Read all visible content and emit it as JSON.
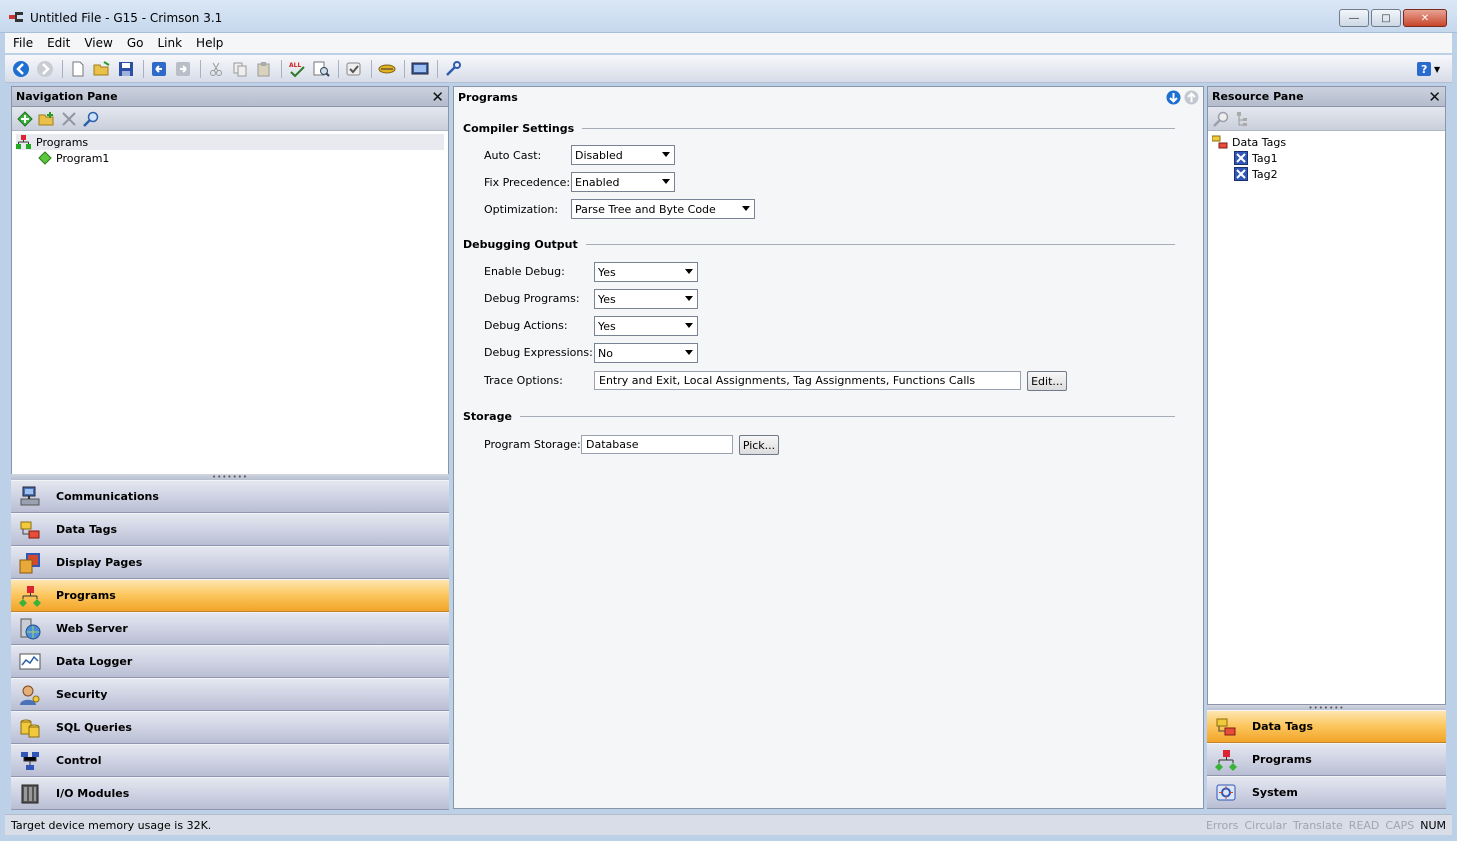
{
  "window": {
    "title": "Untitled File - G15 - Crimson 3.1"
  },
  "menu": [
    "File",
    "Edit",
    "View",
    "Go",
    "Link",
    "Help"
  ],
  "toolbar": {
    "icons": [
      "back-icon",
      "forward-icon",
      "new-file-icon",
      "open-folder-icon",
      "save-icon",
      "undo-icon",
      "redo-icon",
      "cut-icon",
      "copy-icon",
      "paste-icon",
      "spell-check-icon",
      "find-icon",
      "verify-icon",
      "send-icon",
      "screen-icon",
      "tool-icon"
    ],
    "help_icon": "help-icon"
  },
  "nav_pane": {
    "title": "Navigation Pane",
    "tree": [
      {
        "label": "Programs",
        "icon": "programs-icon",
        "level": 0
      },
      {
        "label": "Program1",
        "icon": "program-icon",
        "level": 1
      }
    ],
    "categories": [
      {
        "label": "Communications",
        "icon": "communications-icon",
        "active": false
      },
      {
        "label": "Data Tags",
        "icon": "data-tags-icon",
        "active": false
      },
      {
        "label": "Display Pages",
        "icon": "display-pages-icon",
        "active": false
      },
      {
        "label": "Programs",
        "icon": "programs-icon",
        "active": true
      },
      {
        "label": "Web Server",
        "icon": "web-server-icon",
        "active": false
      },
      {
        "label": "Data Logger",
        "icon": "data-logger-icon",
        "active": false
      },
      {
        "label": "Security",
        "icon": "security-icon",
        "active": false
      },
      {
        "label": "SQL Queries",
        "icon": "sql-queries-icon",
        "active": false
      },
      {
        "label": "Control",
        "icon": "control-icon",
        "active": false
      },
      {
        "label": "I/O Modules",
        "icon": "io-modules-icon",
        "active": false
      }
    ]
  },
  "center": {
    "title": "Programs",
    "compiler": {
      "heading": "Compiler Settings",
      "auto_cast_label": "Auto Cast:",
      "auto_cast_value": "Disabled",
      "fix_precedence_label": "Fix Precedence:",
      "fix_precedence_value": "Enabled",
      "optimization_label": "Optimization:",
      "optimization_value": "Parse Tree and Byte Code"
    },
    "debugging": {
      "heading": "Debugging Output",
      "enable_debug_label": "Enable Debug:",
      "enable_debug_value": "Yes",
      "debug_programs_label": "Debug Programs:",
      "debug_programs_value": "Yes",
      "debug_actions_label": "Debug Actions:",
      "debug_actions_value": "Yes",
      "debug_expressions_label": "Debug Expressions:",
      "debug_expressions_value": "No",
      "trace_options_label": "Trace Options:",
      "trace_options_value": "Entry and Exit, Local Assignments, Tag Assignments, Functions Calls",
      "edit_button": "Edit..."
    },
    "storage": {
      "heading": "Storage",
      "program_storage_label": "Program Storage:",
      "program_storage_value": "Database",
      "pick_button": "Pick..."
    }
  },
  "resource_pane": {
    "title": "Resource Pane",
    "tree": [
      {
        "label": "Data Tags",
        "icon": "data-tags-icon",
        "level": 0
      },
      {
        "label": "Tag1",
        "icon": "tag-icon",
        "level": 1
      },
      {
        "label": "Tag2",
        "icon": "tag-icon",
        "level": 1
      }
    ],
    "categories": [
      {
        "label": "Data Tags",
        "icon": "data-tags-icon",
        "active": true
      },
      {
        "label": "Programs",
        "icon": "programs-icon",
        "active": false
      },
      {
        "label": "System",
        "icon": "system-icon",
        "active": false
      }
    ]
  },
  "status": {
    "message": "Target device memory usage is 32K.",
    "indicators": [
      {
        "label": "Errors",
        "on": false
      },
      {
        "label": "Circular",
        "on": false
      },
      {
        "label": "Translate",
        "on": false
      },
      {
        "label": "READ",
        "on": false
      },
      {
        "label": "CAPS",
        "on": false
      },
      {
        "label": "NUM",
        "on": true
      }
    ]
  }
}
